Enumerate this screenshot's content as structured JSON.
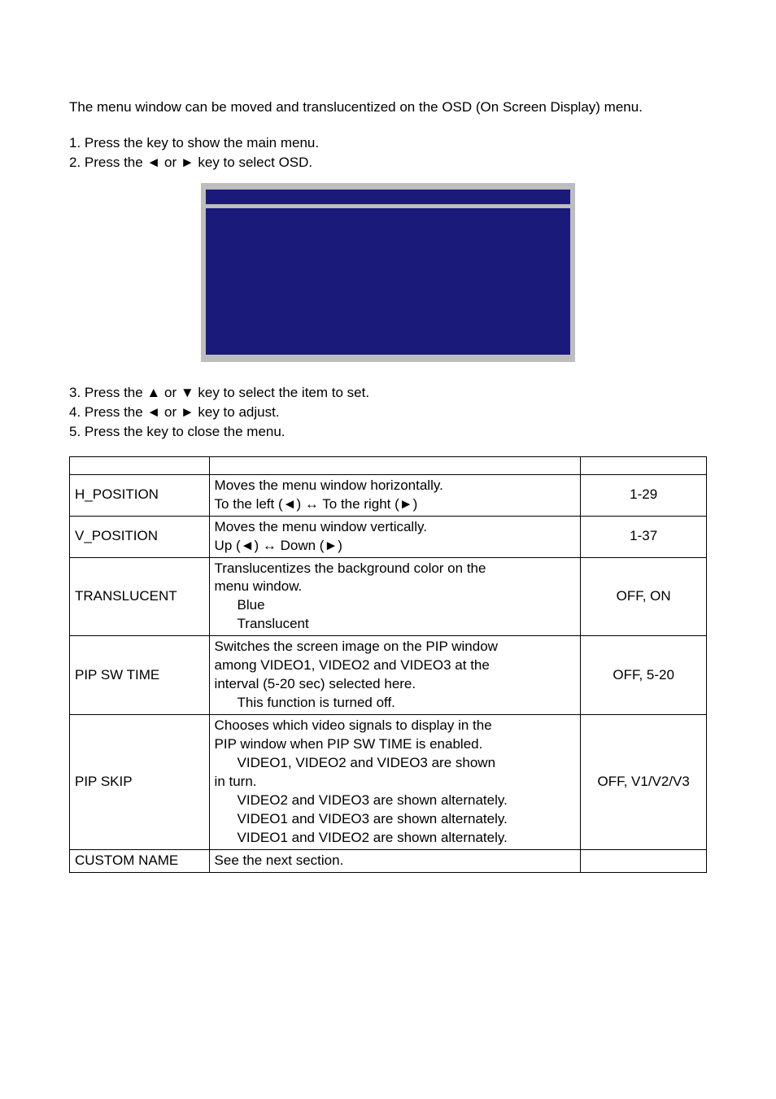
{
  "intro": "The menu window can be moved and translucentized on the OSD (On Screen Display) menu.",
  "steps1": [
    "1.  Press the            key to show the main menu.",
    "2.  Press the ◄ or ► key to select OSD."
  ],
  "steps2": [
    "3.  Press the ▲ or ▼ key to select the item to set.",
    "4.  Press the ◄ or ► key to adjust.",
    "5.  Press the            key to close the menu."
  ],
  "table": {
    "rows": [
      {
        "label": "H_POSITION",
        "desc_lines": [
          "Moves the menu window horizontally.",
          "To the left (◄) ↔ To the right (►)"
        ],
        "value": "1-29"
      },
      {
        "label": "V_POSITION",
        "desc_lines": [
          "Moves the menu window vertically.",
          "Up (◄) ↔ Down (►)"
        ],
        "value": "1-37"
      },
      {
        "label": "TRANSLUCENT",
        "desc_lines": [
          "Translucentizes the background color on the",
          "menu window."
        ],
        "indent_lines": [
          "Blue",
          "Translucent"
        ],
        "value": "OFF, ON"
      },
      {
        "label": "PIP SW TIME",
        "desc_lines": [
          "Switches the screen image on the PIP window",
          "among VIDEO1, VIDEO2 and VIDEO3 at the",
          "interval (5-20 sec) selected here."
        ],
        "indent_lines": [
          "This function is turned off."
        ],
        "value": "OFF, 5-20"
      },
      {
        "label": "PIP SKIP",
        "desc_lines": [
          "Chooses which video signals to display in the",
          "PIP window when PIP SW TIME is enabled."
        ],
        "indent_lines_a": [
          "VIDEO1, VIDEO2 and VIDEO3 are shown"
        ],
        "mid_line": "in turn.",
        "indent_lines_b": [
          "VIDEO2 and VIDEO3 are shown alternately.",
          "VIDEO1 and VIDEO3 are shown alternately.",
          "VIDEO1 and VIDEO2 are shown alternately."
        ],
        "value": "OFF, V1/V2/V3"
      },
      {
        "label": "CUSTOM NAME",
        "desc_lines": [
          "See the next section."
        ],
        "value": ""
      }
    ]
  }
}
